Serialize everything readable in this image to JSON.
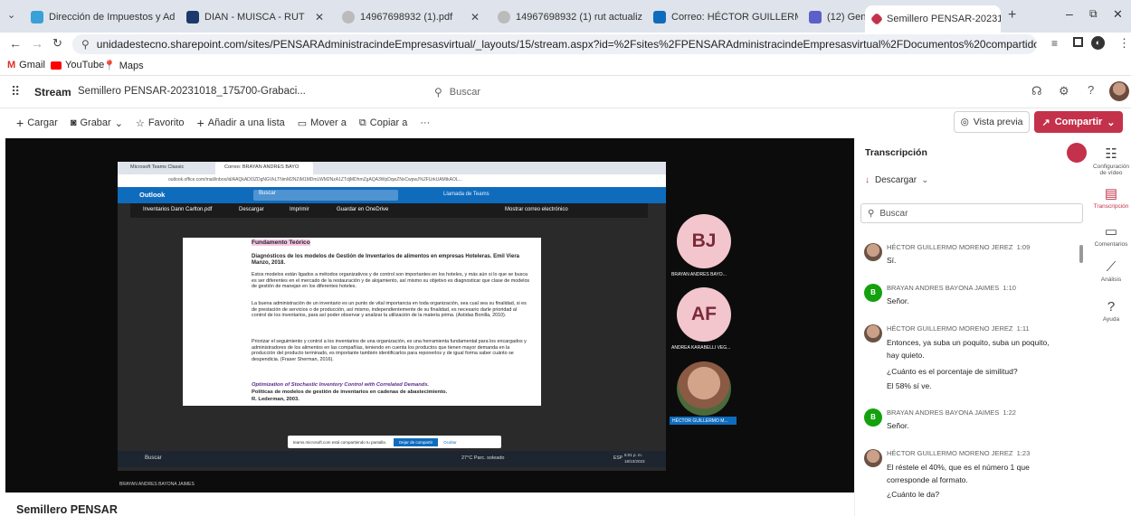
{
  "browser": {
    "tabs": [
      {
        "label": "Dirección de Impuestos y Adua"
      },
      {
        "label": "DIAN - MUISCA - RUT"
      },
      {
        "label": "14967698932 (1).pdf"
      },
      {
        "label": "14967698932 (1) rut actualizad"
      },
      {
        "label": "Correo: HÉCTOR GUILLERMO M"
      },
      {
        "label": "(12) General (PENSAR, Virtual)"
      },
      {
        "label": "Semillero PENSAR-20231018_1"
      }
    ],
    "url": "unidadestecno.sharepoint.com/sites/PENSARAdministracindeEmpresasvirtual/_layouts/15/stream.aspx?id=%2Fsites%2FPENSARAdministracindeEmpresasvirtual%2FDocumentos%20compartidos%2FGeneral%2FRecordings%2FSemillero%20PENSAR-2023...",
    "bookmarks": [
      {
        "label": "Gmail"
      },
      {
        "label": "YouTube"
      },
      {
        "label": "Maps"
      }
    ]
  },
  "stream": {
    "app_name": "Stream",
    "file_name": "Semillero PENSAR-20231018_175700-Grabaci...",
    "search_placeholder": "Buscar",
    "commands": [
      "Cargar",
      "Grabar",
      "Favorito",
      "Añadir a una lista",
      "Mover a",
      "Copiar a"
    ],
    "preview_label": "Vista previa",
    "share_label": "Compartir",
    "video_title": "Semillero PENSAR"
  },
  "transcript": {
    "title": "Transcripción",
    "download_label": "Descargar",
    "search_placeholder": "Buscar",
    "entries": [
      {
        "speaker": "HÉCTOR GUILLERMO MORENO JEREZ",
        "time": "1:09",
        "lines": [
          "Sí."
        ]
      },
      {
        "speaker": "BRAYAN ANDRES BAYONA JAIMES",
        "time": "1:10",
        "lines": [
          "Señor."
        ]
      },
      {
        "speaker": "HÉCTOR GUILLERMO MORENO JEREZ",
        "time": "1:11",
        "lines": [
          "Entonces, ya suba un poquito, suba un poquito,",
          "hay quieto.",
          "¿Cuánto es el porcentaje de similitud?",
          "El 58% sí ve."
        ]
      },
      {
        "speaker": "BRAYAN ANDRES BAYONA JAIMES",
        "time": "1:22",
        "lines": [
          "Señor."
        ]
      },
      {
        "speaker": "HÉCTOR GUILLERMO MORENO JEREZ",
        "time": "1:23",
        "lines": [
          "El réstele el 40%, que es el número 1 que",
          "corresponde al formato.",
          "¿Cuánto le da?"
        ]
      }
    ]
  },
  "rail": [
    {
      "label": "Configuración de vídeo",
      "icon": "settings-slider-icon"
    },
    {
      "label": "Transcripción",
      "icon": "transcript-icon"
    },
    {
      "label": "Comentarios",
      "icon": "comment-icon"
    },
    {
      "label": "Análisis",
      "icon": "chart-icon"
    },
    {
      "label": "Ayuda",
      "icon": "help-icon"
    }
  ],
  "recording": {
    "inner_tabs": [
      "Microsoft Teams Classic",
      "Correo: BRAYAN ANDRES BAYO"
    ],
    "inner_url": "outlook.office.com/mail/inbox/id/AAQkADI3ZDgNGVkLTNmM2NZiM1MDmLWM2NzA1ZTdjMDhmZgAQA3WpDqwZNxCwpwJ%2FUrkUAMtkAOL...",
    "outlook_label": "Outlook",
    "outlook_search": "Buscar",
    "teams_call_label": "Llamada de Teams",
    "attachment_name": "Inventarios Dann Carlton.pdf",
    "attachment_actions": [
      "Descargar",
      "Imprimir",
      "Guardar en OneDrive"
    ],
    "show_email": "Mostrar correo electrónico",
    "doc": {
      "heading": "Fundamento Teórico",
      "ref1_title": "Diagnósticos de los modelos de Gestión de Inventarios de alimentos en empresas Hoteleras. Emil Viera Manzo, 2018.",
      "para1": "Estos modelos están ligados a métodos organizativos y de control son importantes en los hoteles, y más aún si lo que se busca es ser diferentes en el mercado de la restauración y de alojamiento, así mismo su objetivo es diagnosticar que clase de modelos de gestión de manejan en los diferentes hoteles.",
      "para2": "La buena administración de un inventario es un punto de vital importancia en toda organización, sea cual sea su finalidad, si es de prestación de servicios o de producción, así mismo, independientemente de su finalidad, es necesario darle prioridad al control de los inventarios, para así poder observar y analizar la utilización de la materia prima. (Astidas Bonilla, 2010).",
      "para3": "Priorizar el seguimiento y control a los inventarios de una organización, es una herramienta fundamental para los encargados y administradores de los alimentos en las compañías, teniendo en cuenta los productos que tienen mayor demanda en la producción del producto terminado, es importante también identificarlos para reponerlos y de igual forma saber cuánto se despendicia. (Fraser Sherman, 2016).",
      "ref2_title": "Optimization of Stochastic Inventory Control with Correlated Demands.",
      "ref2_sub": "Políticas de modelos de gestión de inventarios en cadenas de abastecimiento.",
      "ref2_author": "R. Lederman, 2003."
    },
    "participants": [
      {
        "initials": "BJ",
        "name": "BRAYAN ANDRES BAYO..."
      },
      {
        "initials": "AF",
        "name": "ANDREA KARABELLI VEG..."
      },
      {
        "initials": "",
        "name": "HÉCTOR GUILLERMO M..."
      }
    ],
    "share_notice": "teams.microsoft.com está compartiendo tu pantalla.",
    "stop_share": "Dejar de compartir",
    "hide": "Ocultar",
    "taskbar_search": "Buscar",
    "weather": "27°C Parc. soleado",
    "clock_time": "6:01 p. m.",
    "clock_date": "18/10/2023",
    "lang": "ESP",
    "presenter_name": "BRAYAN ANDRES BAYONA JAIMES"
  },
  "colors": {
    "accent": "#c4314b",
    "brand_blue": "#0f6cbd",
    "tabstrip": "#dfe3eb"
  }
}
